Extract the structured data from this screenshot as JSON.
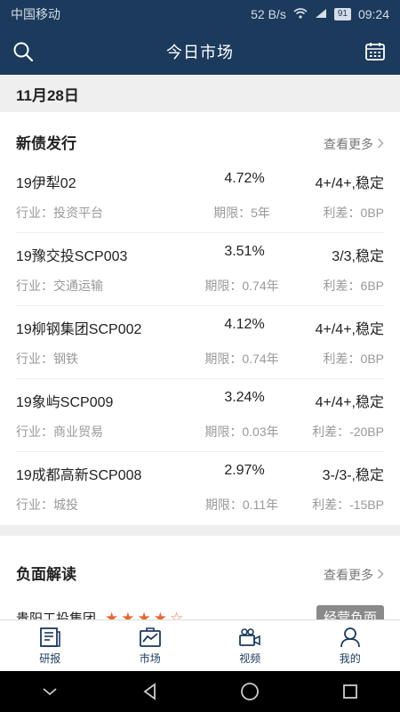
{
  "status": {
    "carrier": "中国移动",
    "speed": "52 B/s",
    "battery": "91",
    "time": "09:24"
  },
  "nav": {
    "title": "今日市场"
  },
  "date_label": "11月28日",
  "new_issues": {
    "title": "新债发行",
    "more": "查看更多",
    "items": [
      {
        "name": "19伊犁02",
        "rate": "4.72%",
        "rating": "4+/4+,稳定",
        "industry": "行业：投资平台",
        "term": "期限：5年",
        "spread": "利差：0BP"
      },
      {
        "name": "19豫交投SCP003",
        "rate": "3.51%",
        "rating": "3/3,稳定",
        "industry": "行业：交通运输",
        "term": "期限：0.74年",
        "spread": "利差：6BP"
      },
      {
        "name": "19柳钢集团SCP002",
        "rate": "4.12%",
        "rating": "4+/4+,稳定",
        "industry": "行业：钢铁",
        "term": "期限：0.74年",
        "spread": "利差：0BP"
      },
      {
        "name": "19象屿SCP009",
        "rate": "3.24%",
        "rating": "4+/4+,稳定",
        "industry": "行业：商业贸易",
        "term": "期限：0.03年",
        "spread": "利差：-20BP"
      },
      {
        "name": "19成都高新SCP008",
        "rate": "2.97%",
        "rating": "3-/3-,稳定",
        "industry": "行业：城投",
        "term": "期限：0.11年",
        "spread": "利差：-15BP"
      }
    ]
  },
  "negative": {
    "title": "负面解读",
    "more": "查看更多",
    "items": [
      {
        "company": "贵阳工投集团",
        "stars": 4,
        "stars_max": 5,
        "tag": "经营负面"
      }
    ]
  },
  "tabs": [
    {
      "label": "研报",
      "icon": "report-icon"
    },
    {
      "label": "市场",
      "icon": "market-icon"
    },
    {
      "label": "视频",
      "icon": "video-icon"
    },
    {
      "label": "我的",
      "icon": "profile-icon"
    }
  ],
  "colors": {
    "primary": "#1b3a5c",
    "star": "#e06b39",
    "badge": "#8a8a8a"
  }
}
